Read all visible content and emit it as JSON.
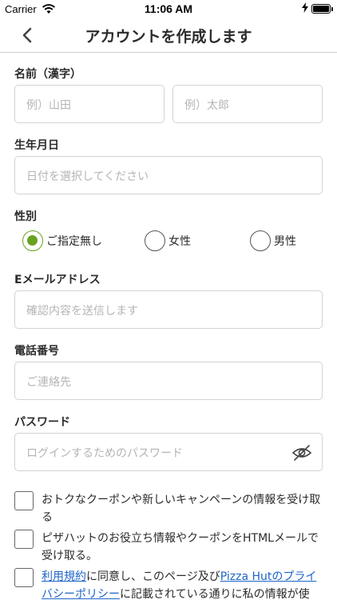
{
  "status_bar": {
    "carrier": "Carrier",
    "time": "11:06 AM"
  },
  "header": {
    "title": "アカウントを作成します"
  },
  "form": {
    "name": {
      "label": "名前（漢字）",
      "last_placeholder": "例）山田",
      "first_placeholder": "例）太郎"
    },
    "birthday": {
      "label": "生年月日",
      "placeholder": "日付を選択してください"
    },
    "gender": {
      "label": "性別",
      "options": [
        "ご指定無し",
        "女性",
        "男性"
      ],
      "selected": "ご指定無し"
    },
    "email": {
      "label": "Eメールアドレス",
      "placeholder": "確認内容を送信します"
    },
    "phone": {
      "label": "電話番号",
      "placeholder": "ご連絡先"
    },
    "password": {
      "label": "パスワード",
      "placeholder": "ログインするためのパスワード"
    },
    "checkboxes": {
      "coupons": "おトクなクーポンや新しいキャンペーンの情報を受け取る",
      "html_mail": "ピザハットのお役立ち情報やクーポンをHTMLメールで受け取る。",
      "terms_link": "利用規約",
      "terms_mid": "に同意し、このページ及び",
      "privacy_link": "Pizza Hutのプライバシーポリシー",
      "terms_end": "に記載されている通りに私の情報が使"
    }
  },
  "colors": {
    "accent_green": "#6aa121",
    "link_blue": "#1e64c8"
  },
  "icons": {
    "back": "chevron-left-icon",
    "wifi": "wifi-icon",
    "battery": "battery-icon",
    "password_toggle": "eye-slash-icon"
  }
}
